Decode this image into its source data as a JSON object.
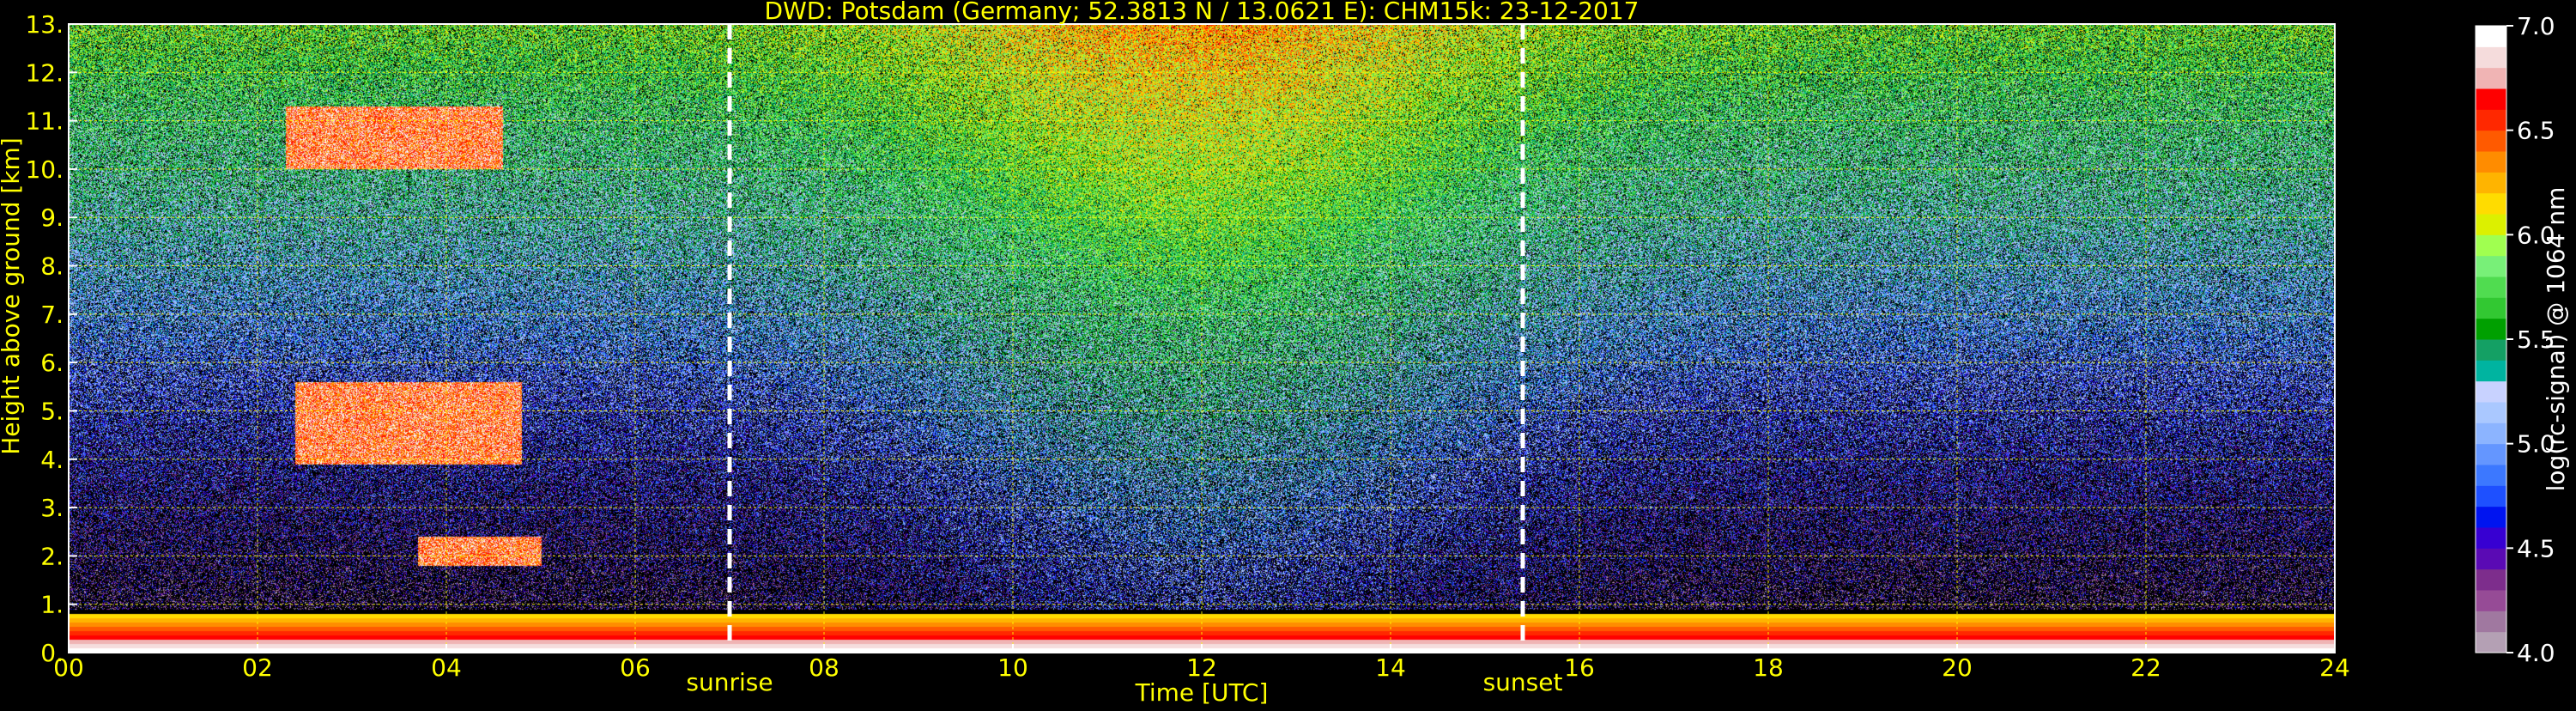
{
  "chart_data": {
    "type": "heatmap",
    "title": "DWD: Potsdam (Germany; 52.3813 N / 13.0621 E):    CHM15k: 23-12-2017",
    "xlabel": "Time [UTC]",
    "ylabel": "Height above ground [km]",
    "xlim": [
      0,
      24
    ],
    "ylim": [
      0,
      13
    ],
    "x_ticks": [
      "00",
      "02",
      "04",
      "06",
      "08",
      "10",
      "12",
      "14",
      "16",
      "18",
      "20",
      "22",
      "24"
    ],
    "y_ticks": [
      "0.",
      "1.",
      "2.",
      "3.",
      "4.",
      "5.",
      "6.",
      "7.",
      "8.",
      "9.",
      "10.",
      "11.",
      "12.",
      "13."
    ],
    "grid": true,
    "annotations": [
      {
        "label": "sunrise",
        "x": 7.0
      },
      {
        "label": "sunset",
        "x": 15.4
      }
    ],
    "colorbar": {
      "label": "log(rc-signal) @ 1064 nm",
      "range": [
        4.0,
        7.0
      ],
      "ticks": [
        "4.0",
        "4.5",
        "5.0",
        "5.5",
        "6.0",
        "6.5",
        "7.0"
      ],
      "colors": [
        "#b4a0b4",
        "#a078a0",
        "#964b96",
        "#7d2d8c",
        "#5a0ab4",
        "#3700d2",
        "#0014f0",
        "#1e50ff",
        "#3c78ff",
        "#6496ff",
        "#8cb4ff",
        "#aac8ff",
        "#c8d2ff",
        "#00b4a0",
        "#14a064",
        "#00a000",
        "#32c832",
        "#50dc50",
        "#78f078",
        "#a0ff50",
        "#dcf000",
        "#ffdc00",
        "#ffb400",
        "#ff8c00",
        "#ff5a00",
        "#ff2800",
        "#ff0000",
        "#f0b4b4",
        "#f5dcdc",
        "#ffffff"
      ]
    },
    "features": [
      {
        "name": "boundary-layer signal",
        "t_start": 0,
        "t_end": 24,
        "top_km": 0.8
      },
      {
        "name": "cirrus",
        "t_start": 2.3,
        "t_end": 4.6,
        "base_km": 10.0,
        "top_km": 11.3
      },
      {
        "name": "mid-level cloud",
        "t_start": 2.4,
        "t_end": 4.8,
        "base_km": 3.9,
        "top_km": 5.6
      },
      {
        "name": "low cloud",
        "t_start": 3.7,
        "t_end": 5.0,
        "base_km": 1.8,
        "top_km": 2.4
      }
    ]
  },
  "colors": {
    "axis_text": "#ffff00",
    "grid": "#ffff00",
    "frame": "#ffffff",
    "background": "#000000",
    "annotation_line": "#ffffff"
  }
}
